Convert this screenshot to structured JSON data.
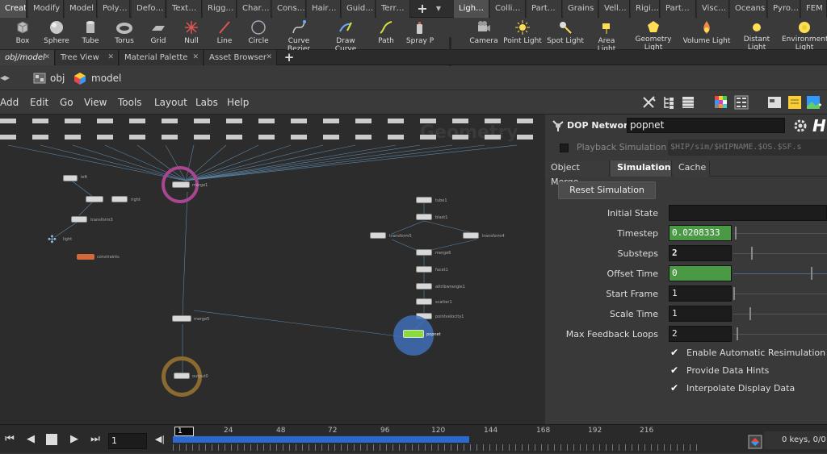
{
  "shelf_tabs": [
    "Create",
    "Modify",
    "Model",
    "Poly…",
    "Defo…",
    "Text…",
    "Rigg…",
    "Char…",
    "Cons…",
    "Hair…",
    "Guid…",
    "Terr…",
    "Ligh…",
    "Colli…",
    "Part…",
    "Grains",
    "Vell…",
    "Rigi…",
    "Part…",
    "Visc…",
    "Oceans",
    "Pyro…",
    "FEM"
  ],
  "shelf_tools_left": [
    {
      "label": "Box",
      "icon": "box-icon"
    },
    {
      "label": "Sphere",
      "icon": "sphere-icon"
    },
    {
      "label": "Tube",
      "icon": "tube-icon"
    },
    {
      "label": "Torus",
      "icon": "torus-icon"
    },
    {
      "label": "Grid",
      "icon": "grid-icon"
    },
    {
      "label": "Null",
      "icon": "null-icon"
    },
    {
      "label": "Line",
      "icon": "line-icon"
    },
    {
      "label": "Circle",
      "icon": "circle-icon"
    },
    {
      "label": "Curve Bezier",
      "icon": "curve-bezier-icon"
    },
    {
      "label": "Draw Curve",
      "icon": "draw-curve-icon"
    },
    {
      "label": "Path",
      "icon": "path-icon"
    },
    {
      "label": "Spray P",
      "icon": "spray-paint-icon"
    }
  ],
  "shelf_tools_right": [
    {
      "label": "Camera",
      "icon": "camera-icon"
    },
    {
      "label": "Point Light",
      "icon": "point-light-icon"
    },
    {
      "label": "Spot Light",
      "icon": "spot-light-icon"
    },
    {
      "label": "Area Light",
      "icon": "area-light-icon"
    },
    {
      "label": "Geometry Light",
      "icon": "geometry-light-icon"
    },
    {
      "label": "Volume Light",
      "icon": "volume-light-icon"
    },
    {
      "label": "Distant Light",
      "icon": "distant-light-icon"
    },
    {
      "label": "Environment Light",
      "icon": "environment-light-icon"
    }
  ],
  "pane_tabs": [
    {
      "label": "obj/model",
      "active": true
    },
    {
      "label": "Tree View",
      "active": false
    },
    {
      "label": "Material Palette",
      "active": false
    },
    {
      "label": "Asset Browser",
      "active": false
    }
  ],
  "path": {
    "root": "obj",
    "current": "model"
  },
  "menu": [
    "Add",
    "Edit",
    "Go",
    "View",
    "Tools",
    "Layout",
    "Labs",
    "Help"
  ],
  "network": {
    "watermark": "Geometry",
    "nodes": [
      {
        "name": "left"
      },
      {
        "name": "right"
      },
      {
        "name": "transform3"
      },
      {
        "name": "light"
      },
      {
        "name": "constraints"
      },
      {
        "name": "merge1"
      },
      {
        "name": "tube1"
      },
      {
        "name": "blast1"
      },
      {
        "name": "transform5"
      },
      {
        "name": "transform4"
      },
      {
        "name": "merge6"
      },
      {
        "name": "facet1"
      },
      {
        "name": "attribwrangle1"
      },
      {
        "name": "scatter1"
      },
      {
        "name": "pointvelocity1"
      },
      {
        "name": "popnet"
      },
      {
        "name": "merge5"
      },
      {
        "name": "output0"
      }
    ]
  },
  "params": {
    "type_label": "DOP Network",
    "node_name": "popnet",
    "playback_label": "Playback Simulation",
    "playback_path": "$HIP/sim/$HIPNAME.$OS.$SF.s",
    "tabs": [
      "Object Merge",
      "Simulation",
      "Cache"
    ],
    "active_tab": "Simulation",
    "reset_label": "Reset Simulation",
    "rows": [
      {
        "label": "Initial State",
        "value": ""
      },
      {
        "label": "Timestep",
        "value": "0.0208333"
      },
      {
        "label": "Substeps",
        "value": "2"
      },
      {
        "label": "Offset Time",
        "value": "0"
      },
      {
        "label": "Start Frame",
        "value": "1"
      },
      {
        "label": "Scale Time",
        "value": "1"
      },
      {
        "label": "Max Feedback Loops",
        "value": "2"
      }
    ],
    "checks": [
      "Enable Automatic Resimulation",
      "Provide Data Hints",
      "Interpolate Display Data"
    ]
  },
  "timeline": {
    "frame": "1",
    "current": "1",
    "ticks": [
      "24",
      "48",
      "72",
      "96",
      "120",
      "144",
      "168",
      "192",
      "216"
    ],
    "keys": "0 keys, 0/0"
  },
  "colors": {
    "accent_green": "#4a9a45",
    "selection_ring": "#3f6fb8",
    "merge_ring": "#a8478f",
    "output_ring": "#8a6a30"
  }
}
